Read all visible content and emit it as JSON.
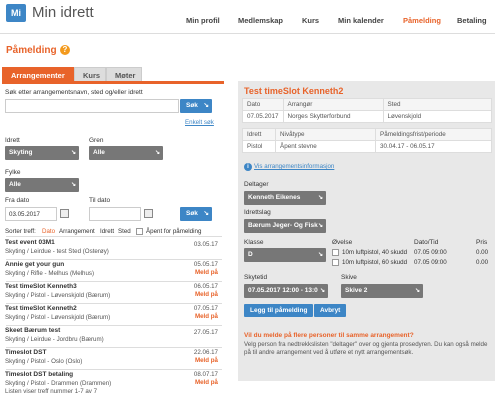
{
  "header": {
    "logo_letters": "Mi",
    "app_title": "Min idrett",
    "nav": [
      "Min profil",
      "Medlemskap",
      "Kurs",
      "Min kalender",
      "Påmelding",
      "Betaling"
    ],
    "active_nav": "Påmelding"
  },
  "page": {
    "title": "Påmelding",
    "help_icon": "?"
  },
  "tabs": [
    "Arrangementer",
    "Kurs",
    "Møter"
  ],
  "search": {
    "label": "Søk etter arrangementsnavn, sted og/eller idrett",
    "value": "",
    "button": "Søk",
    "advanced_link": "Enkelt søk"
  },
  "filters": {
    "idrett_label": "Idrett",
    "idrett_value": "Skyting",
    "gren_label": "Gren",
    "gren_value": "Alle",
    "fylke_label": "Fylke",
    "fylke_value": "Alle",
    "fra_dato_label": "Fra dato",
    "fra_dato_value": "03.05.2017",
    "til_dato_label": "Til dato",
    "til_dato_value": "",
    "search_button": "Søk",
    "open_label": "Åpent for påmelding"
  },
  "sort": {
    "label": "Sorter treff:",
    "options": [
      "Dato",
      "Arrangement",
      "Idrett",
      "Sted"
    ]
  },
  "events": [
    {
      "title": "Test event 03M1",
      "sub": "Skyting / Leirdue - test Sted (Osterøy)",
      "date": "03.05.17",
      "status": ""
    },
    {
      "title": "Annie get your gun",
      "sub": "Skyting / Rifle - Melhus (Melhus)",
      "date": "05.05.17",
      "status": "Meld på"
    },
    {
      "title": "Test timeSlot Kenneth3",
      "sub": "Skyting / Pistol - Løvenskjold (Bærum)",
      "date": "06.05.17",
      "status": "Meld på"
    },
    {
      "title": "Test timeSlot Kenneth2",
      "sub": "Skyting / Pistol - Løvenskjold (Bærum)",
      "date": "07.05.17",
      "status": "Meld på"
    },
    {
      "title": "Skeet Bærum test",
      "sub": "Skyting / Leirdue - Jordbru (Bærum)",
      "date": "27.05.17",
      "status": ""
    },
    {
      "title": "Timeslot DST",
      "sub": "Skyting / Pistol - Oslo (Oslo)",
      "date": "22.06.17",
      "status": "Meld på"
    },
    {
      "title": "Timeslot DST betaling",
      "sub": "Skyting / Pistol - Drammen (Drammen)",
      "date": "08.07.17",
      "status": "Meld på"
    }
  ],
  "results_text": "Listen viser treff nummer 1-7 av 7",
  "detail": {
    "title": "Test timeSlot Kenneth2",
    "table1_headers": [
      "Dato",
      "Arrangør",
      "Sted"
    ],
    "table1_values": [
      "07.05.2017",
      "Norges Skytterforbund",
      "Løvenskjold"
    ],
    "table2_headers": [
      "Idrett",
      "Nivåtype",
      "Påmeldingsfrist/periode"
    ],
    "table2_values": [
      "Pistol",
      "Åpent stevne",
      "30.04.17 - 06.05.17"
    ],
    "info_link": "Vis arrangementsinformasjon",
    "deltager_label": "Deltager",
    "deltager_value": "Kenneth Eikenes",
    "idrettslag_label": "Idrettslag",
    "idrettslag_value": "Bærum Jeger- Og Fisk",
    "klasse_label": "Klasse",
    "klasse_value": "D",
    "ovelse_label": "Øvelse",
    "datotid_label": "Dato/Tid",
    "pris_label": "Pris",
    "ovelser": [
      {
        "name": "10m luftpistol, 40 skudd",
        "datetime": "07.05 09:00",
        "price": "0.00"
      },
      {
        "name": "10m luftpistol, 60 skudd",
        "datetime": "07.05 09:00",
        "price": "0.00"
      }
    ],
    "skytetid_label": "Skytetid",
    "skytetid_value": "07.05.2017 12:00 - 13:0",
    "skive_label": "Skive",
    "skive_value": "Skive 2",
    "add_button": "Legg til påmelding",
    "cancel_button": "Avbryt",
    "notice_title": "Vil du melde på flere personer til samme arrangement?",
    "notice_text": "Velg person fra nedtrekkslisten \"deltager\" over og gjenta prosedyren. Du kan også melde på til andre arrangement ved å utføre et nytt arrangementsøk."
  },
  "colors": {
    "accent": "#e8632a",
    "blue": "#3d86c6",
    "select_bg": "#777777"
  }
}
